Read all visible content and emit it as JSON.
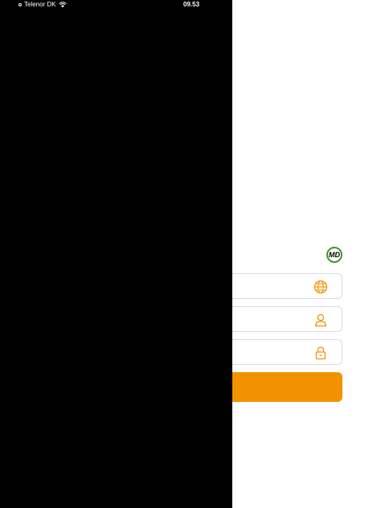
{
  "status_bar": {
    "carrier": "Telenor DK",
    "time": "09.53",
    "signal_bars_filled": 4,
    "signal_bars_total": 5
  },
  "login": {
    "logo_text": "MD",
    "server_placeholder": "",
    "username_placeholder": "",
    "password_placeholder": "",
    "login_button_label": ""
  },
  "colors": {
    "accent": "#f39200",
    "drawer": "#000000",
    "logo_ring": "#3f9a26",
    "field_border": "#dcdcdc"
  },
  "icons": {
    "server": "globe-icon",
    "username": "user-icon",
    "password": "lock-icon"
  }
}
